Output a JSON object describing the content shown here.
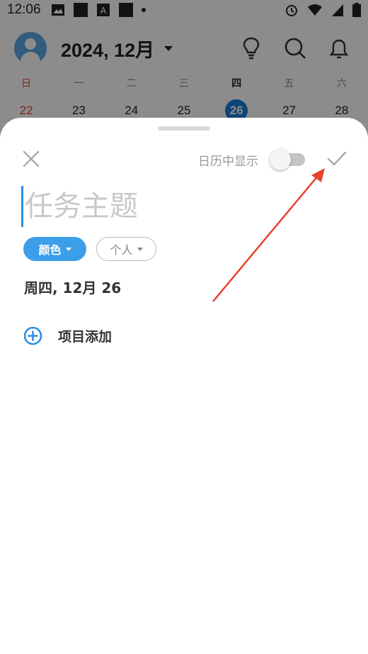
{
  "status_bar": {
    "time": "12:06",
    "icons": [
      "image-icon",
      "square-icon",
      "a-box-icon",
      "square-icon",
      "dot-icon",
      "alarm-icon",
      "wifi-icon",
      "signal-icon",
      "battery-icon"
    ]
  },
  "calendar": {
    "title": "2024, 12月",
    "weekdays": [
      "日",
      "一",
      "二",
      "三",
      "四",
      "五",
      "六"
    ],
    "days": [
      "22",
      "23",
      "24",
      "25",
      "26",
      "27",
      "28"
    ],
    "selected_day": "26",
    "header_icons": [
      "lightbulb-icon",
      "search-icon",
      "bell-icon"
    ]
  },
  "sheet": {
    "show_in_calendar_label": "日历中显示",
    "show_in_calendar_on": false,
    "title_placeholder": "任务主题",
    "title_value": "",
    "color_chip_label": "颜色",
    "person_chip_label": "个人",
    "date_label": "周四, 12月 26",
    "add_item_label": "项目添加"
  },
  "colors": {
    "accent": "#3c9ee8",
    "selected_day_bg": "#1a7fd9",
    "sunday": "#e04a3c",
    "annotation_arrow": "#e8412c"
  }
}
